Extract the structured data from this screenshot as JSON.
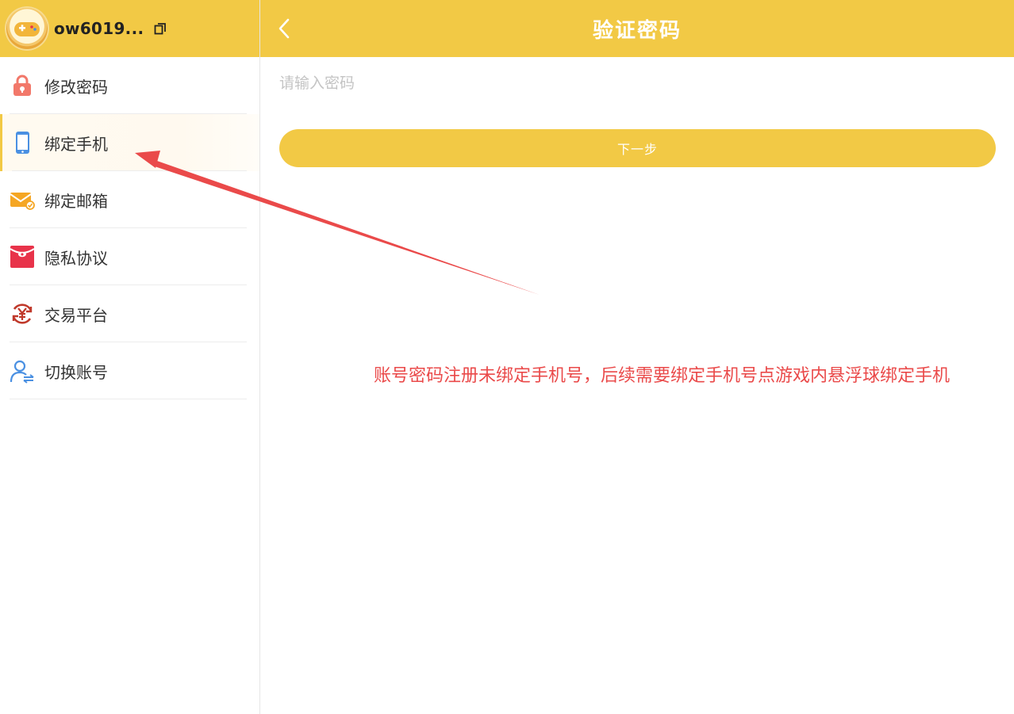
{
  "sidebar": {
    "username": "ow6019...",
    "items": [
      {
        "label": "修改密码",
        "icon": "lock-icon",
        "active": false
      },
      {
        "label": "绑定手机",
        "icon": "phone-icon",
        "active": true
      },
      {
        "label": "绑定邮箱",
        "icon": "mail-icon",
        "active": false
      },
      {
        "label": "隐私协议",
        "icon": "privacy-envelope-icon",
        "active": false
      },
      {
        "label": "交易平台",
        "icon": "yuan-exchange-icon",
        "active": false
      },
      {
        "label": "切换账号",
        "icon": "switch-user-icon",
        "active": false
      }
    ]
  },
  "main": {
    "title": "验证密码",
    "password_placeholder": "请输入密码",
    "next_label": "下一步"
  },
  "annotation": {
    "text": "账号密码注册未绑定手机号，后续需要绑定手机号点游戏内悬浮球绑定手机"
  },
  "colors": {
    "header": "#f2c945",
    "accent_text": "#ffffff",
    "annotation": "#ea4a4a",
    "lock": "#f2786a",
    "phone": "#4a90e2",
    "mail": "#f5a623",
    "privacy": "#e8334a",
    "trade": "#c0392b",
    "switch": "#4a90e2"
  }
}
